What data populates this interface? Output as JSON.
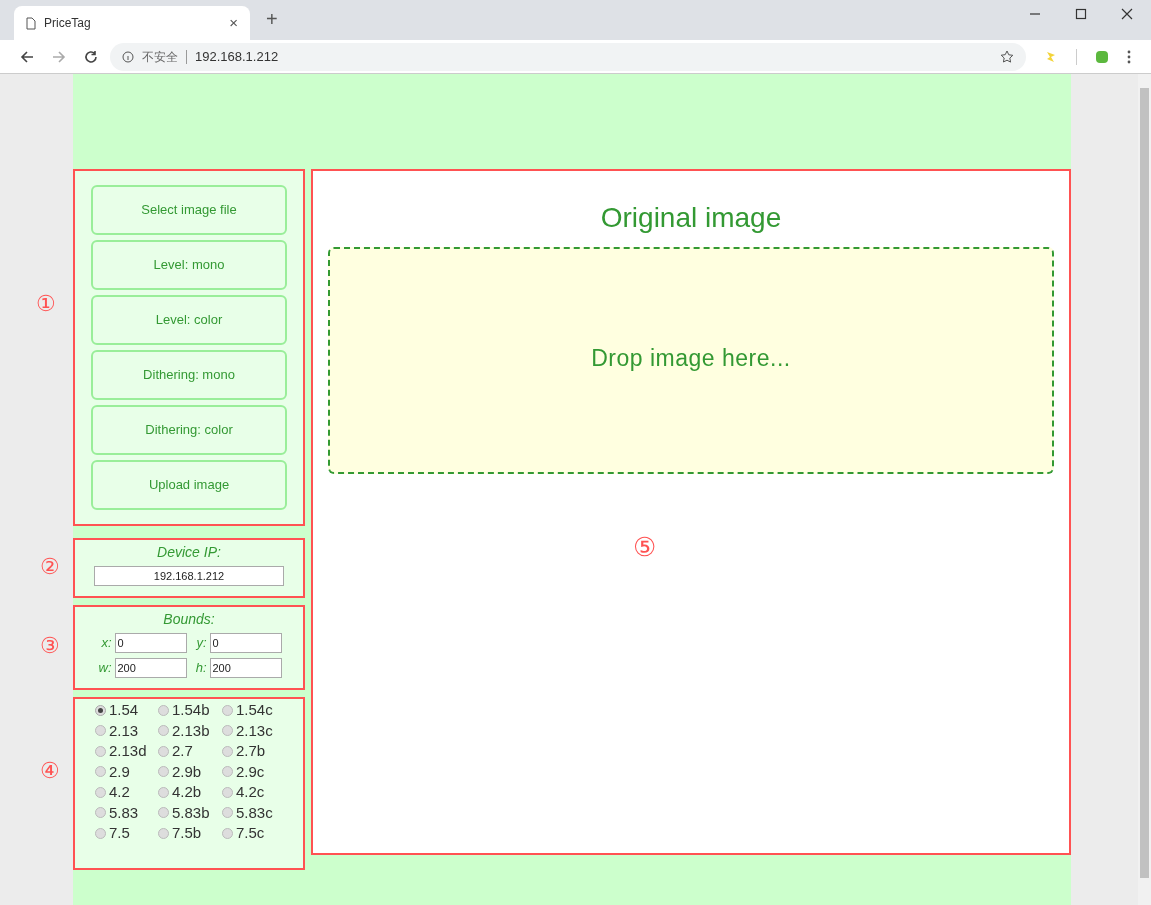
{
  "browser": {
    "tab_title": "PriceTag",
    "new_tab": "+",
    "close_tab": "×",
    "security_label": "不安全",
    "url": "192.168.1.212"
  },
  "callouts": [
    "①",
    "②",
    "③",
    "④",
    "⑤"
  ],
  "actions": [
    "Select image file",
    "Level: mono",
    "Level: color",
    "Dithering: mono",
    "Dithering: color",
    "Upload image"
  ],
  "device_ip": {
    "label": "Device IP:",
    "value": "192.168.1.212"
  },
  "bounds": {
    "label": "Bounds:",
    "fields": [
      {
        "label": "x:",
        "value": "0"
      },
      {
        "label": "y:",
        "value": "0"
      },
      {
        "label": "w:",
        "value": "200"
      },
      {
        "label": "h:",
        "value": "200"
      }
    ]
  },
  "display_types": [
    {
      "label": "1.54",
      "selected": true
    },
    {
      "label": "1.54b",
      "selected": false
    },
    {
      "label": "1.54c",
      "selected": false
    },
    {
      "label": "2.13",
      "selected": false
    },
    {
      "label": "2.13b",
      "selected": false
    },
    {
      "label": "2.13c",
      "selected": false
    },
    {
      "label": "2.13d",
      "selected": false
    },
    {
      "label": "2.7",
      "selected": false
    },
    {
      "label": "2.7b",
      "selected": false
    },
    {
      "label": "2.9",
      "selected": false
    },
    {
      "label": "2.9b",
      "selected": false
    },
    {
      "label": "2.9c",
      "selected": false
    },
    {
      "label": "4.2",
      "selected": false
    },
    {
      "label": "4.2b",
      "selected": false
    },
    {
      "label": "4.2c",
      "selected": false
    },
    {
      "label": "5.83",
      "selected": false
    },
    {
      "label": "5.83b",
      "selected": false
    },
    {
      "label": "5.83c",
      "selected": false
    },
    {
      "label": "7.5",
      "selected": false
    },
    {
      "label": "7.5b",
      "selected": false
    },
    {
      "label": "7.5c",
      "selected": false
    }
  ],
  "main": {
    "title": "Original image",
    "drop_hint": "Drop image here..."
  }
}
